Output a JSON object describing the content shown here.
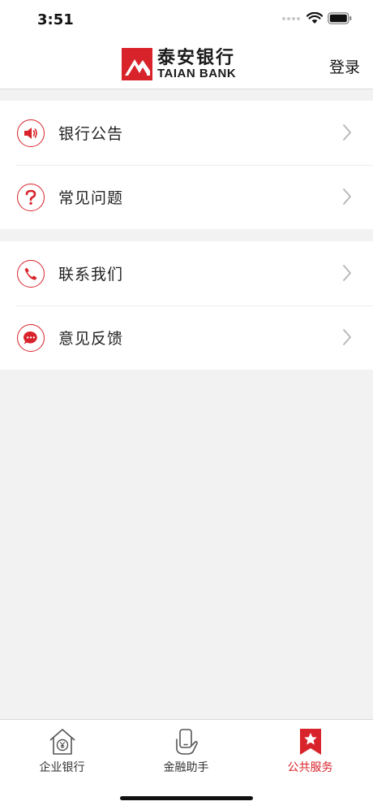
{
  "status_bar": {
    "time": "3:51"
  },
  "header": {
    "logo_cn": "泰安银行",
    "logo_en": "TAIAN BANK",
    "login_label": "登录"
  },
  "menu": {
    "groups": [
      {
        "items": [
          {
            "label": "银行公告",
            "icon": "speaker-icon"
          },
          {
            "label": "常见问题",
            "icon": "question-icon"
          }
        ]
      },
      {
        "items": [
          {
            "label": "联系我们",
            "icon": "phone-icon"
          },
          {
            "label": "意见反馈",
            "icon": "chat-bubble-icon"
          }
        ]
      }
    ]
  },
  "tab_bar": {
    "tabs": [
      {
        "label": "企业银行",
        "icon": "house-yen-icon",
        "active": false
      },
      {
        "label": "金融助手",
        "icon": "phone-hand-icon",
        "active": false
      },
      {
        "label": "公共服务",
        "icon": "star-bookmark-icon",
        "active": true
      }
    ]
  },
  "colors": {
    "accent": "#d8232a",
    "background": "#f2f2f2",
    "chevron": "#b5b5b5"
  }
}
